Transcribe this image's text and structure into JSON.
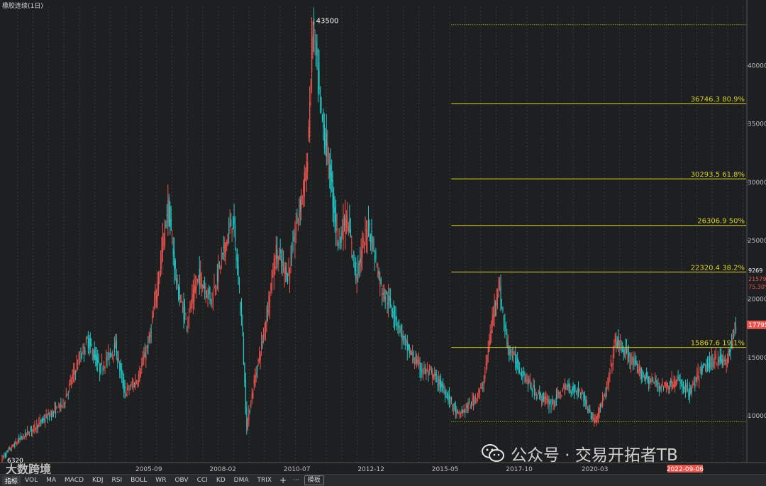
{
  "header": {
    "title": "橡胶连续(1日)"
  },
  "chart_data": {
    "type": "candlestick",
    "title": "橡胶连续(1日)",
    "ylim": [
      6000,
      45000
    ],
    "yticks": [
      10000,
      15000,
      20000,
      25000,
      30000,
      35000,
      40000
    ],
    "xticks": [
      "2005-09",
      "2008-02",
      "2010-07",
      "2012-12",
      "2015-05",
      "2017-10",
      "2020-03"
    ],
    "current_date_label": "2022-09-06",
    "high_label": "43500",
    "low_label": "6320",
    "price_path": [
      {
        "t": 2001.0,
        "p": 6320
      },
      {
        "t": 2001.6,
        "p": 8000
      },
      {
        "t": 2002.3,
        "p": 9500
      },
      {
        "t": 2003.0,
        "p": 11000
      },
      {
        "t": 2003.4,
        "p": 14000
      },
      {
        "t": 2003.8,
        "p": 16500
      },
      {
        "t": 2004.2,
        "p": 14000
      },
      {
        "t": 2004.7,
        "p": 16000
      },
      {
        "t": 2005.0,
        "p": 12000
      },
      {
        "t": 2005.4,
        "p": 13000
      },
      {
        "t": 2005.8,
        "p": 16500
      },
      {
        "t": 2006.1,
        "p": 22000
      },
      {
        "t": 2006.4,
        "p": 28000
      },
      {
        "t": 2006.7,
        "p": 21000
      },
      {
        "t": 2007.0,
        "p": 18000
      },
      {
        "t": 2007.4,
        "p": 22000
      },
      {
        "t": 2007.8,
        "p": 20000
      },
      {
        "t": 2008.2,
        "p": 24000
      },
      {
        "t": 2008.5,
        "p": 27000
      },
      {
        "t": 2008.8,
        "p": 18000
      },
      {
        "t": 2008.95,
        "p": 9000
      },
      {
        "t": 2009.2,
        "p": 13000
      },
      {
        "t": 2009.5,
        "p": 17000
      },
      {
        "t": 2009.9,
        "p": 24000
      },
      {
        "t": 2010.3,
        "p": 22000
      },
      {
        "t": 2010.6,
        "p": 27000
      },
      {
        "t": 2010.9,
        "p": 31000
      },
      {
        "t": 2011.1,
        "p": 43500
      },
      {
        "t": 2011.35,
        "p": 36000
      },
      {
        "t": 2011.6,
        "p": 32000
      },
      {
        "t": 2011.9,
        "p": 25000
      },
      {
        "t": 2012.2,
        "p": 27000
      },
      {
        "t": 2012.5,
        "p": 22000
      },
      {
        "t": 2012.9,
        "p": 26500
      },
      {
        "t": 2013.3,
        "p": 21000
      },
      {
        "t": 2013.7,
        "p": 19000
      },
      {
        "t": 2014.1,
        "p": 16000
      },
      {
        "t": 2014.6,
        "p": 14000
      },
      {
        "t": 2015.0,
        "p": 13500
      },
      {
        "t": 2015.4,
        "p": 12000
      },
      {
        "t": 2015.8,
        "p": 10000
      },
      {
        "t": 2016.2,
        "p": 11000
      },
      {
        "t": 2016.6,
        "p": 12500
      },
      {
        "t": 2016.9,
        "p": 18000
      },
      {
        "t": 2017.1,
        "p": 21500
      },
      {
        "t": 2017.4,
        "p": 16000
      },
      {
        "t": 2017.8,
        "p": 14000
      },
      {
        "t": 2018.3,
        "p": 12000
      },
      {
        "t": 2018.8,
        "p": 11000
      },
      {
        "t": 2019.3,
        "p": 12500
      },
      {
        "t": 2019.8,
        "p": 12000
      },
      {
        "t": 2020.2,
        "p": 9500
      },
      {
        "t": 2020.6,
        "p": 12000
      },
      {
        "t": 2020.9,
        "p": 16500
      },
      {
        "t": 2021.2,
        "p": 15500
      },
      {
        "t": 2021.6,
        "p": 14000
      },
      {
        "t": 2022.0,
        "p": 13000
      },
      {
        "t": 2022.5,
        "p": 12500
      },
      {
        "t": 2022.9,
        "p": 13000
      },
      {
        "t": 2023.3,
        "p": 12000
      },
      {
        "t": 2023.7,
        "p": 14000
      },
      {
        "t": 2024.2,
        "p": 15000
      },
      {
        "t": 2024.5,
        "p": 14500
      },
      {
        "t": 2024.8,
        "p": 17795
      }
    ],
    "fib_high": 43500,
    "fib_low": 9500,
    "fib_levels": [
      {
        "value": 36746.3,
        "label": "36746.3 80.9%"
      },
      {
        "value": 30293.5,
        "label": "30293.5 61.8%"
      },
      {
        "value": 26306.9,
        "label": "26306.9 50%"
      },
      {
        "value": 22320.4,
        "label": "22320.4 38.2%"
      },
      {
        "value": 15867.6,
        "label": "15867.6 19.1%"
      }
    ],
    "right_labels": {
      "info1": "9269",
      "info2": "21579",
      "info3": "75.30%",
      "last_price": "17795"
    },
    "colors": {
      "up": "#e8534e",
      "down": "#21c5c5",
      "fib": "#d6d12a",
      "grid": "#3a3a3a",
      "badge": "#e8534e"
    }
  },
  "toolbar": {
    "items": [
      "指标",
      "VOL",
      "MA",
      "MACD",
      "KDJ",
      "RSI",
      "BOLL",
      "WR",
      "OBV",
      "CCI",
      "KD",
      "DMA",
      "TRIX"
    ],
    "plus": "+",
    "more": "···",
    "template": "模板"
  },
  "watermark": {
    "text": "公众号 · 交易开拓者TB",
    "logo": "大数跨境"
  }
}
